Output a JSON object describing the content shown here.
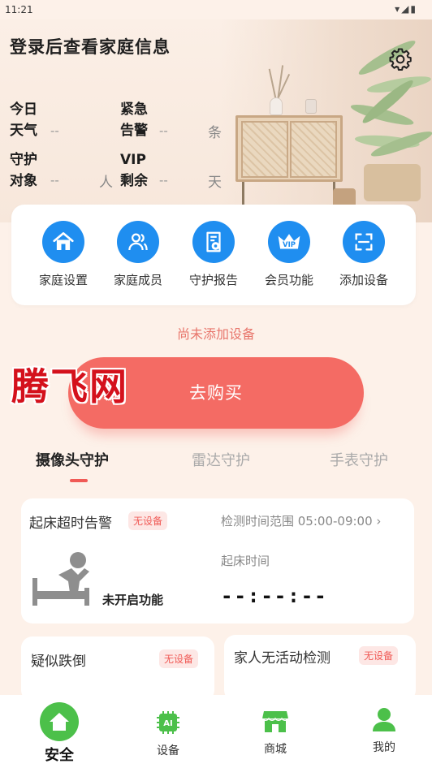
{
  "status_bar": {
    "time": "11:21",
    "icons": "▾◢▮"
  },
  "hero": {
    "title": "登录后查看家庭信息",
    "stats": [
      {
        "label_line1": "今日",
        "label_line2": "天气",
        "value": "--",
        "unit": ""
      },
      {
        "label_line1": "紧急",
        "label_line2": "告警",
        "value": "--",
        "unit": "条"
      },
      {
        "label_line1": "守护",
        "label_line2": "对象",
        "value": "--",
        "unit": "人"
      },
      {
        "label_line1": "VIP",
        "label_line2": "剩余",
        "value": "--",
        "unit": "天"
      }
    ]
  },
  "menu": [
    {
      "label": "家庭设置",
      "icon": "home-icon"
    },
    {
      "label": "家庭成员",
      "icon": "members-icon"
    },
    {
      "label": "守护报告",
      "icon": "report-icon"
    },
    {
      "label": "会员功能",
      "icon": "vip-crown-icon"
    },
    {
      "label": "添加设备",
      "icon": "scan-icon"
    }
  ],
  "notice": "尚未添加设备",
  "buy_button": "去购买",
  "watermark": "腾飞网",
  "tabs": [
    {
      "label": "摄像头守护",
      "active": true
    },
    {
      "label": "雷达守护",
      "active": false
    },
    {
      "label": "手表守护",
      "active": false
    }
  ],
  "wake_card": {
    "title": "起床超时告警",
    "badge": "无设备",
    "range": "检测时间范围 05:00-09:00 ›",
    "status": "未开启功能",
    "time_label": "起床时间",
    "time_value": "--:--:--"
  },
  "fall_card": {
    "title": "疑似跌倒",
    "badge": "无设备"
  },
  "inactive_card": {
    "title": "家人无活动检测",
    "badge": "无设备"
  },
  "bottom_nav": [
    {
      "label": "安全",
      "icon": "shield-home-icon",
      "active": true
    },
    {
      "label": "设备",
      "icon": "ai-chip-icon",
      "active": false
    },
    {
      "label": "商城",
      "icon": "store-icon",
      "active": false
    },
    {
      "label": "我的",
      "icon": "profile-icon",
      "active": false
    }
  ],
  "colors": {
    "accent_blue": "#1f8ef0",
    "accent_red": "#f46b64",
    "nav_green": "#4cc04a"
  }
}
